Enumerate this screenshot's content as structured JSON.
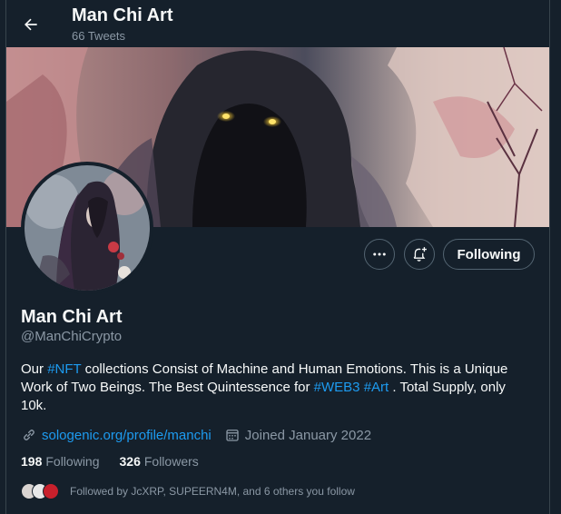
{
  "header": {
    "title": "Man Chi Art",
    "tweet_count": "66 Tweets"
  },
  "profile": {
    "name": "Man Chi Art",
    "handle": "@ManChiCrypto",
    "bio": {
      "p1": "Our ",
      "tag1": "#NFT",
      "p2": " collections Consist of Machine and Human Emotions. This is a Unique Work of Two Beings. The Best Quintessence for ",
      "tag2": "#WEB3",
      "p3": " ",
      "tag3": "#Art",
      "p4": " . Total Supply, only 10k."
    },
    "website": "sologenic.org/profile/manchi",
    "joined": "Joined January 2022"
  },
  "actions": {
    "follow_label": "Following"
  },
  "stats": {
    "following_count": "198",
    "following_label": "Following",
    "followers_count": "326",
    "followers_label": "Followers"
  },
  "followed_by": "Followed by JcXRP, SUPEERN4M, and 6 others you follow",
  "colors": {
    "background": "#15202b",
    "accent": "#1d9bf0",
    "muted": "#8b98a5"
  }
}
